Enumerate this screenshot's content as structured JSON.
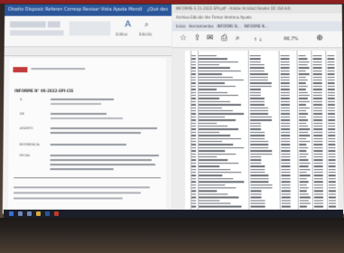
{
  "word": {
    "title": "Diseño  Disposic  Referen  Corresp  Revisar  Vista  Ayuda  Mendl",
    "search": "¿Qué des",
    "toolbar_labels": [
      "Estilos",
      "Edición"
    ],
    "doc_heading": "INFORME N° 00-2022-SPI-CIS",
    "rows": [
      "A",
      "DE",
      "ASUNTO",
      "REFERENCIA",
      "FECHA"
    ]
  },
  "pdf": {
    "title": "INFORME-S 21-2022-SPI.pdf - Adobe Acrobat Reader DC (64-bit)",
    "menu": "Archivo  Edición  Ver  Firmar  Ventana  Ayuda",
    "tabs": [
      "Inicio",
      "Herramientas",
      "INFORME N...",
      "INFORME N..."
    ],
    "zoom": "66,7%"
  },
  "icons": {
    "star": "star-icon",
    "search": "search-icon",
    "print": "print-icon",
    "mail": "mail-icon",
    "zoom": "zoom-icon"
  },
  "colors": {
    "word_blue": "#2b579a",
    "accent_red": "#8c1f1f"
  }
}
